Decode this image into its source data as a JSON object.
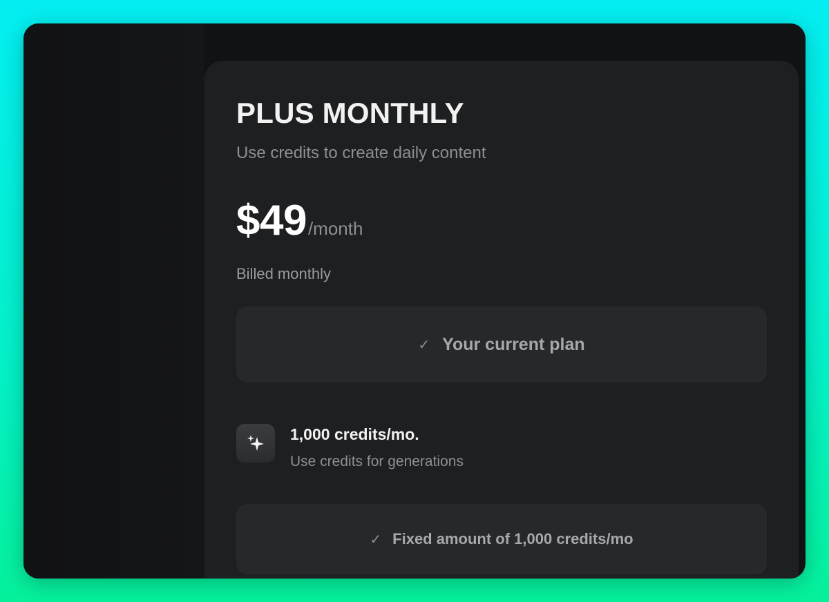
{
  "plan": {
    "title": "PLUS MONTHLY",
    "subtitle": "Use credits to create daily content",
    "price": "$49",
    "period": "/month",
    "billing": "Billed monthly",
    "current_plan_label": "Your current plan"
  },
  "feature": {
    "icon": "sparkles-icon",
    "title": "1,000 credits/mo.",
    "subtitle": "Use credits for generations"
  },
  "fixed_amount": {
    "label": "Fixed amount of 1,000 credits/mo"
  },
  "colors": {
    "background_gradient_top": "#04eef2",
    "background_gradient_bottom": "#05f09a",
    "window": "#111214",
    "card": "#1e1f21",
    "button": "#27282b"
  }
}
